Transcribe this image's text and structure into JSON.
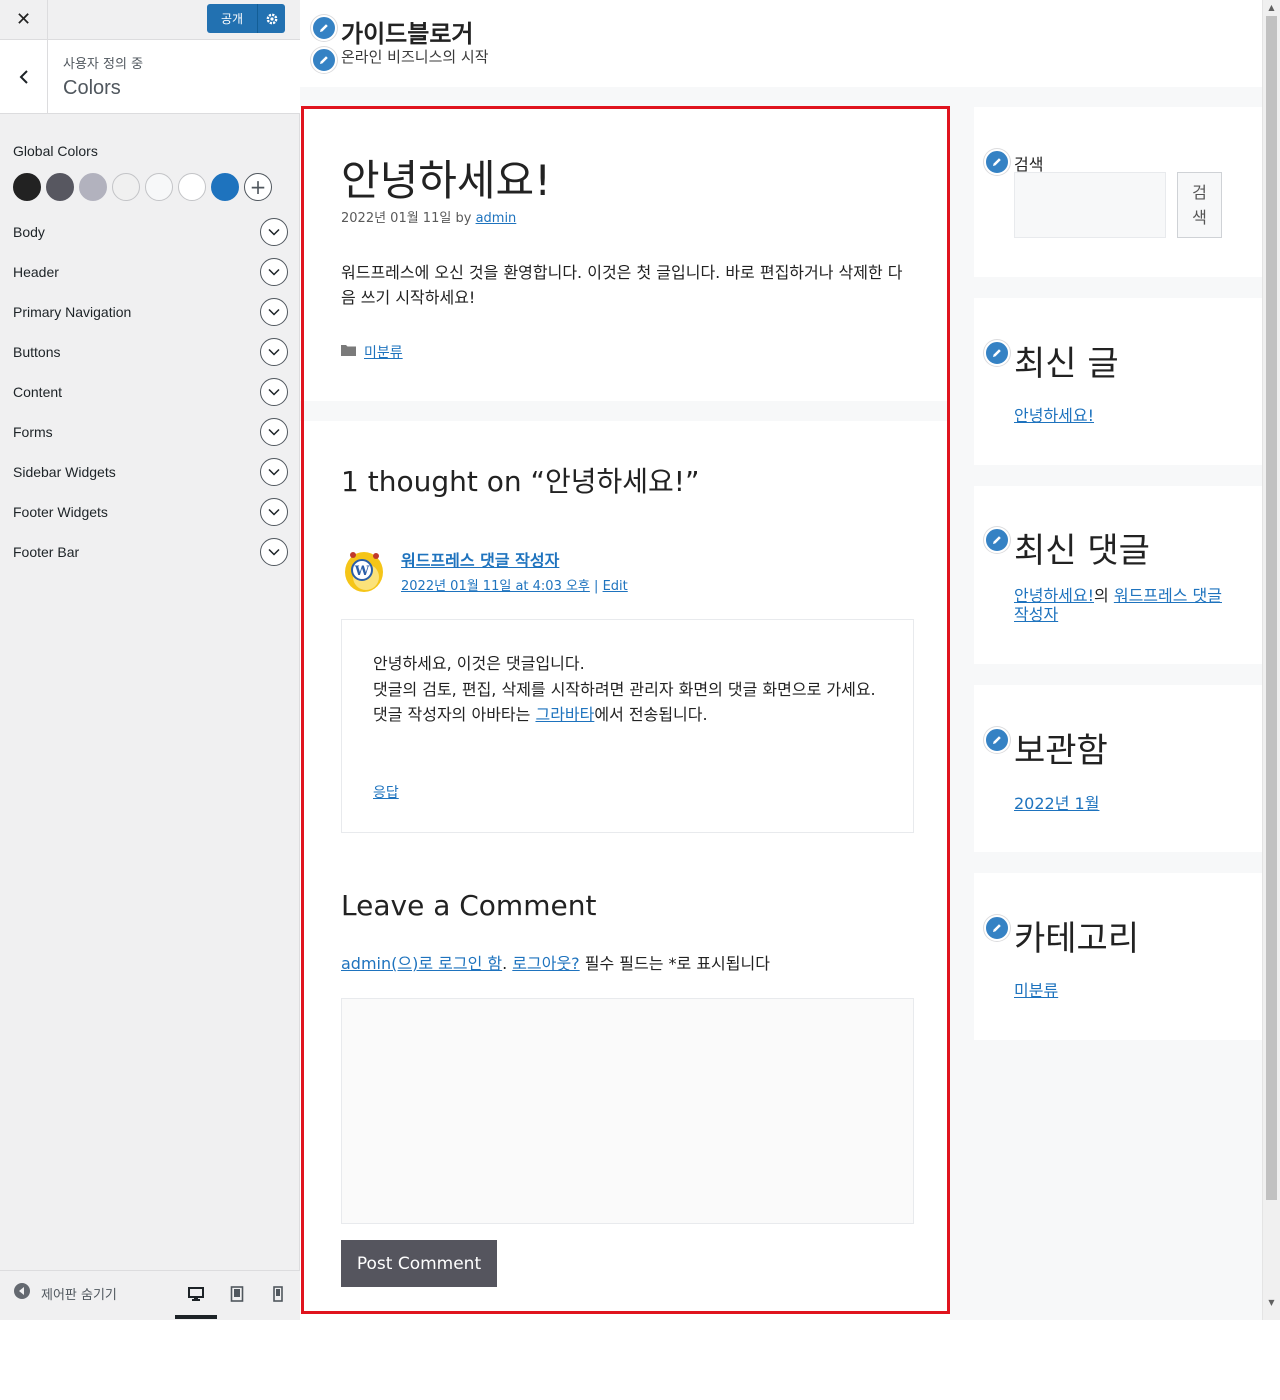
{
  "customizer": {
    "publish_label": "공개",
    "subheading": "사용자 정의 중",
    "section_title": "Colors",
    "global_colors_label": "Global Colors",
    "swatches": [
      "#222222",
      "#575760",
      "#b2b2be",
      "#f0f0f0",
      "#f7f8f9",
      "#ffffff",
      "#1e73be"
    ],
    "sections": [
      {
        "label": "Body"
      },
      {
        "label": "Header"
      },
      {
        "label": "Primary Navigation"
      },
      {
        "label": "Buttons"
      },
      {
        "label": "Content"
      },
      {
        "label": "Forms"
      },
      {
        "label": "Sidebar Widgets"
      },
      {
        "label": "Footer Widgets"
      },
      {
        "label": "Footer Bar"
      }
    ],
    "hide_controls_label": "제어판 숨기기",
    "devices": [
      "desktop-icon",
      "tablet-icon",
      "mobile-icon"
    ]
  },
  "site": {
    "title": "가이드블로거",
    "tagline": "온라인 비즈니스의 시작"
  },
  "post": {
    "title": "안녕하세요!",
    "date": "2022년 01월 11일",
    "by": "by",
    "author": "admin",
    "body": "워드프레스에 오신 것을 환영합니다. 이것은 첫 글입니다. 바로 편집하거나 삭제한 다음 쓰기 시작하세요!",
    "category": "미분류"
  },
  "comments": {
    "title": "1 thought on “안녕하세요!”",
    "author": "워드프레스 댓글 작성자",
    "date": "2022년 01월 11일 at 4:03 오후",
    "separator": "|",
    "edit": "Edit",
    "lines": [
      "안녕하세요, 이것은 댓글입니다.",
      "댓글의 검토, 편집, 삭제를 시작하려면 관리자 화면의 댓글 화면으로 가세요."
    ],
    "avatar_line_before": "댓글 작성자의 아바타는 ",
    "avatar_link": "그라바타",
    "avatar_line_after": "에서 전송됩니다.",
    "reply": "응답"
  },
  "respond": {
    "title": "Leave a Comment",
    "logged_in_link": "admin(으)로 로그인 함",
    "dot": ".",
    "logout_link": "로그아웃?",
    "required_note": " 필수 필드는 *로 표시됩니다",
    "submit": "Post Comment"
  },
  "sidebar": {
    "search_label": "검색",
    "search_button": "검색",
    "recent_posts_title": "최신 글",
    "recent_post": "안녕하세요!",
    "recent_comments_title": "최신 댓글",
    "recent_comment_post": "안녕하세요!",
    "recent_comment_of": "의",
    "recent_comment_author": "워드프레스 댓글 작성자",
    "archives_title": "보관함",
    "archive_item": "2022년 1월",
    "categories_title": "카테고리",
    "category_item": "미분류"
  },
  "colors": {
    "accent": "#1e73be",
    "highlight": "#e0141e",
    "publish": "#2271b1",
    "submit": "#55555e"
  }
}
